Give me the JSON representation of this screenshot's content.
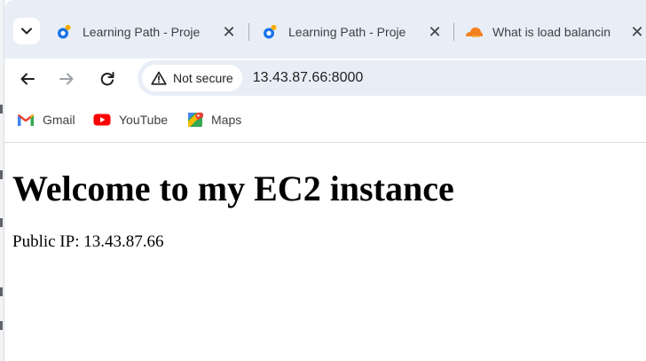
{
  "tabs": [
    {
      "title": "Learning Path - Proje",
      "icon": "app-logo-icon",
      "close": "✕"
    },
    {
      "title": "Learning Path - Proje",
      "icon": "app-logo-icon",
      "close": "✕"
    },
    {
      "title": "What is load balancin",
      "icon": "cloudflare-icon",
      "close": "✕"
    }
  ],
  "toolbar": {
    "security_label": "Not secure",
    "url": "13.43.87.66:8000"
  },
  "bookmarks": [
    {
      "label": "Gmail",
      "icon": "gmail-icon"
    },
    {
      "label": "YouTube",
      "icon": "youtube-icon"
    },
    {
      "label": "Maps",
      "icon": "maps-icon"
    }
  ],
  "page": {
    "heading": "Welcome to my EC2 instance",
    "ip_line": "Public IP: 13.43.87.66"
  }
}
